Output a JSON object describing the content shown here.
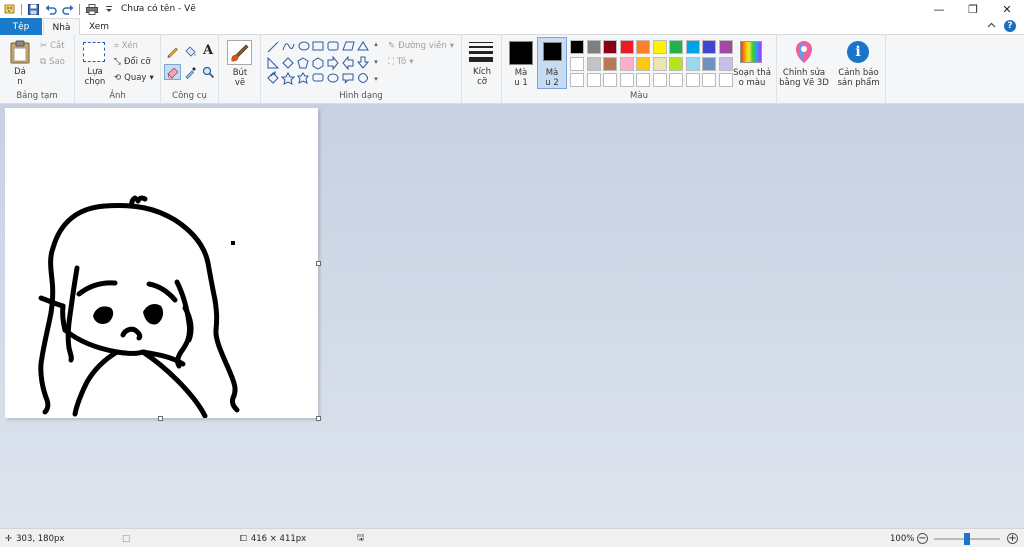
{
  "titlebar": {
    "title": "Chưa có tên - Vẽ",
    "controls": {
      "minimize": "—",
      "restore": "❐",
      "close": "✕"
    }
  },
  "tabs": {
    "file": "Tệp",
    "home": "Nhà",
    "view": "Xem"
  },
  "ribbon": {
    "clipboard": {
      "paste": "Dá\nn",
      "cut": "Cắt",
      "copy": "Sao",
      "label": "Bảng tạm"
    },
    "image": {
      "select": "Lựa\nchọn",
      "crop": "Xén",
      "resize": "Đổi cỡ",
      "rotate": "Quay",
      "label": "Ảnh"
    },
    "tools": {
      "label": "Công cụ",
      "text_tool": "A"
    },
    "brushes": {
      "label": "Bút\nvẽ"
    },
    "shapes": {
      "outline": "Đường viền",
      "fill": "Tô",
      "label": "Hình dạng"
    },
    "size": {
      "label": "Kích\ncỡ"
    },
    "colors": {
      "color1": "Mà\nu 1",
      "color2": "Mà\nu 2",
      "edit_colors": "Soạn thả\no màu",
      "label": "Màu",
      "color1_value": "#000000",
      "color2_value": "#000000",
      "row1": [
        "#000000",
        "#7f7f7f",
        "#880015",
        "#ed1c24",
        "#ff7f27",
        "#fff200",
        "#22b14c",
        "#00a2e8",
        "#3f48cc",
        "#a349a4"
      ],
      "row2": [
        "#ffffff",
        "#c3c3c3",
        "#b97a57",
        "#ffaec9",
        "#ffc90e",
        "#efe4b0",
        "#b5e61d",
        "#99d9ea",
        "#7092be",
        "#c8bfe7"
      ],
      "row3": [
        "#ffffff",
        "#ffffff",
        "#ffffff",
        "#ffffff",
        "#ffffff",
        "#ffffff",
        "#ffffff",
        "#ffffff",
        "#ffffff",
        "#ffffff"
      ]
    },
    "paint3d": {
      "label": "Chỉnh sửa\nbằng Vẽ 3D"
    },
    "alert": {
      "label": "Cảnh báo\nsản phẩm"
    }
  },
  "statusbar": {
    "cursor_pos": "303, 180px",
    "canvas_size": "416 × 411px",
    "zoom": "100%",
    "zoom_slider_percent": 0.5
  }
}
